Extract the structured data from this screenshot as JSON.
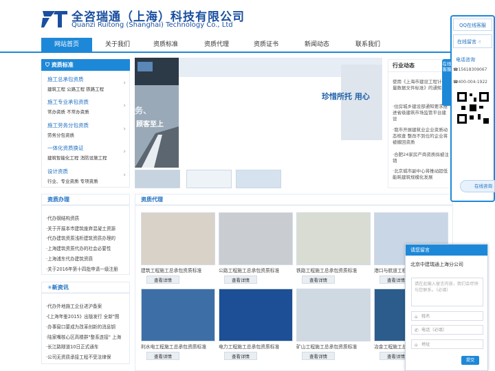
{
  "brand": {
    "cn": "全咨瑞通（上海）科技有限公司",
    "en": "Quanzi Ruitong (Shanghai) Technology Co., Ltd"
  },
  "nav": [
    "网站首页",
    "关于我们",
    "资质标准",
    "资质代理",
    "资质证书",
    "新闻动态",
    "联系我们"
  ],
  "quals": {
    "title": "资质标准",
    "groups": [
      {
        "t": "施工总承包资质",
        "s": "建筑工程  公路工程  铁路工程"
      },
      {
        "t": "施工专业承包资质",
        "s": "常办资质  不常办资质"
      },
      {
        "t": "施工劳务分包资质",
        "s": "劳务分包资质"
      },
      {
        "t": "一体化资质换证",
        "s": "建筑智能化工程  消防设施工程"
      },
      {
        "t": "设计资质",
        "s": "行业、专业资质  专项资质"
      }
    ]
  },
  "banner": {
    "t1": "务、",
    "t2": "顾客至上",
    "t3": "珍惜所托  用心"
  },
  "news": {
    "title": "行业动态",
    "items": [
      "使用《上海市建设工程计量量数据文件标准》的通知",
      "·住房城乡建设部通知要求推进省级建筑市场监管平台建设",
      "·我市开展建筑业企业资质动态核查 整改不到位的企业将被撤回资质",
      "·合肥24家房产商资质拟被注销",
      "·北京城市副中心将推动超低能耗建筑规模化发展"
    ]
  },
  "qual_office": {
    "title": "资质办理",
    "items": [
      "·代办钢结构资质",
      "·关于开展本市建筑废弃混凝土资源",
      "·代办建筑资质浅析建筑资质办理的",
      "·上海建筑资质代办的社会必要性",
      "·上海浦东代办建筑资质",
      "·关于2016年第十四批申请一级注册"
    ]
  },
  "latest": {
    "title": "新资讯",
    "items": [
      "·代办外地施工企业进沪备案",
      "·《上海年鉴2015》出版发行 全新\"图",
      "·办事窗口要成为改革创新的消息钥",
      "·陆家嘴核心区高楼群\"整系连接\" 上海",
      "·长江路隧道10日正式通车",
      "·公司无资质承接工程不受法律保"
    ]
  },
  "agency": {
    "title": "资质代理",
    "btn": "查看详情",
    "items": [
      "建筑工程施工总承包资质标准",
      "公路工程施工总承包资质标准",
      "铁路工程施工总承包资质标准",
      "港口与航道工程",
      "利水电工程施工总承包资质标准",
      "电力工程施工总承包资质标准",
      "矿山工程施工总承包资质标准",
      "冶金工程施工总"
    ]
  },
  "service": {
    "qq": "QQ在线客服",
    "msg": "在线留言",
    "side": "在线客服",
    "phone_title": "电话咨询",
    "phone1": "15618309067",
    "phone2": "400-004-1922",
    "online": "在线咨询"
  },
  "chat": {
    "header": "请您留言",
    "company": "北京中建瑞通上海分公司",
    "placeholder": "请在此输入留言内容，我们会尽快与您联系。（必填）",
    "name": "姓名",
    "phone": "电话（必填）",
    "addr": "地址",
    "submit": "提交"
  },
  "colors": {
    "primary": "#1e88d8",
    "brand": "#1a4fa0"
  }
}
